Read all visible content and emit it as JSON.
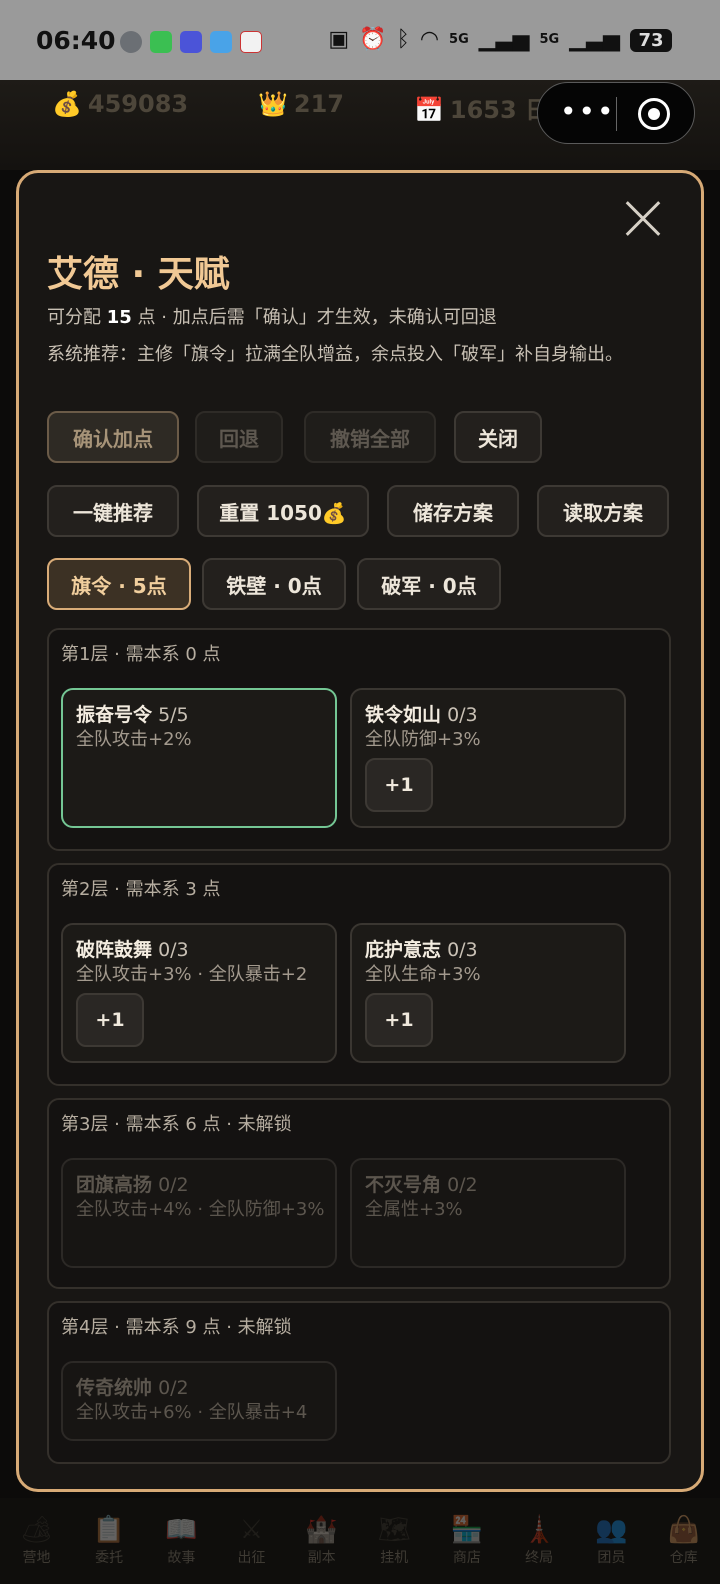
{
  "status_bar": {
    "time": "06:40",
    "icons": [
      "nfc-icon",
      "alarm-icon",
      "bluetooth-icon",
      "wifi-icon"
    ],
    "signal_labels": [
      "5G",
      "5G"
    ],
    "battery": "73"
  },
  "game_header": {
    "gold": "459083",
    "crown": "217",
    "day": "1653 日"
  },
  "modal": {
    "title": "艾德 · 天赋",
    "line1_prefix": "可分配",
    "points": "15",
    "line1_suffix": "点 · 加点后需「确认」才生效，未确认可回退",
    "recommend": "系统推荐：主修「旗令」拉满全队增益，余点投入「破军」补自身输出。",
    "actions": {
      "confirm": "确认加点",
      "undo": "回退",
      "revert_all": "撤销全部",
      "close": "关闭"
    },
    "tools": {
      "one_click": "一键推荐",
      "reset": "重置 1050💰",
      "save": "储存方案",
      "load": "读取方案"
    },
    "tabs": [
      {
        "label": "旗令 · 5点"
      },
      {
        "label": "铁壁 · 0点"
      },
      {
        "label": "破军 · 0点"
      }
    ],
    "layers": [
      {
        "title": "第1层 · 需本系 0 点",
        "cards": [
          {
            "name": "振奋号令",
            "progress": "5/5",
            "desc": "全队攻击+2%"
          },
          {
            "name": "铁令如山",
            "progress": "0/3",
            "desc": "全队防御+3%",
            "button": "+1"
          }
        ]
      },
      {
        "title": "第2层 · 需本系 3 点",
        "cards": [
          {
            "name": "破阵鼓舞",
            "progress": "0/3",
            "desc": "全队攻击+3% · 全队暴击+2",
            "button": "+1"
          },
          {
            "name": "庇护意志",
            "progress": "0/3",
            "desc": "全队生命+3%",
            "button": "+1"
          }
        ]
      },
      {
        "title": "第3层 · 需本系 6 点 · 未解锁",
        "cards": [
          {
            "name": "团旗高扬",
            "progress": "0/2",
            "desc": "全队攻击+4% · 全队防御+3%"
          },
          {
            "name": "不灭号角",
            "progress": "0/2",
            "desc": "全属性+3%"
          }
        ]
      },
      {
        "title": "第4层 · 需本系 9 点 · 未解锁",
        "cards": [
          {
            "name": "传奇统帅",
            "progress": "0/2",
            "desc": "全队攻击+6% · 全队暴击+4"
          }
        ]
      }
    ]
  },
  "bottom_nav": [
    {
      "label": "营地",
      "icon": "camp-icon"
    },
    {
      "label": "委托",
      "icon": "clipboard-icon"
    },
    {
      "label": "故事",
      "icon": "book-icon"
    },
    {
      "label": "出征",
      "icon": "swords-icon"
    },
    {
      "label": "副本",
      "icon": "castle-icon"
    },
    {
      "label": "挂机",
      "icon": "map-icon"
    },
    {
      "label": "商店",
      "icon": "shop-icon"
    },
    {
      "label": "终局",
      "icon": "tower-icon"
    },
    {
      "label": "团员",
      "icon": "members-icon"
    },
    {
      "label": "仓库",
      "icon": "bag-icon"
    }
  ]
}
